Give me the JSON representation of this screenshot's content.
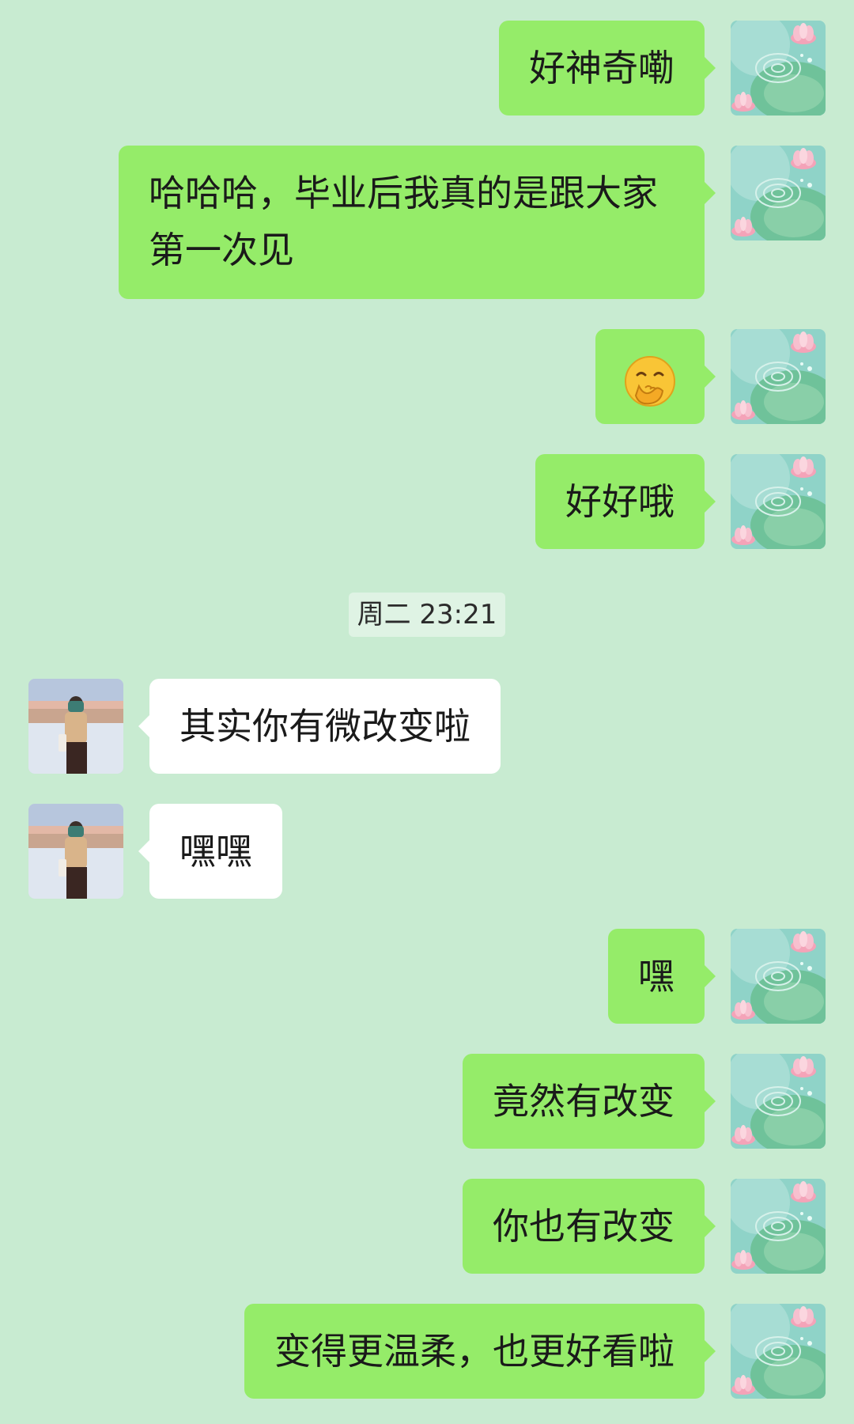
{
  "colors": {
    "background": "#c8ebd1",
    "outgoing_bubble": "#95ec69",
    "incoming_bubble": "#ffffff"
  },
  "avatars": {
    "me": "lotus-pond-avatar",
    "other": "girl-by-sea-avatar"
  },
  "messages": [
    {
      "from": "me",
      "text": "好神奇嘞"
    },
    {
      "from": "me",
      "text": "哈哈哈，毕业后我真的是跟大家第一次见"
    },
    {
      "from": "me",
      "emoji": "face-with-hand-over-mouth"
    },
    {
      "from": "me",
      "text": "好好哦"
    },
    {
      "timestamp": "周二 23:21"
    },
    {
      "from": "other",
      "text": "其实你有微改变啦"
    },
    {
      "from": "other",
      "text": "嘿嘿"
    },
    {
      "from": "me",
      "text": "嘿"
    },
    {
      "from": "me",
      "text": "竟然有改变"
    },
    {
      "from": "me",
      "text": "你也有改变"
    },
    {
      "from": "me",
      "text": "变得更温柔，也更好看啦"
    }
  ]
}
